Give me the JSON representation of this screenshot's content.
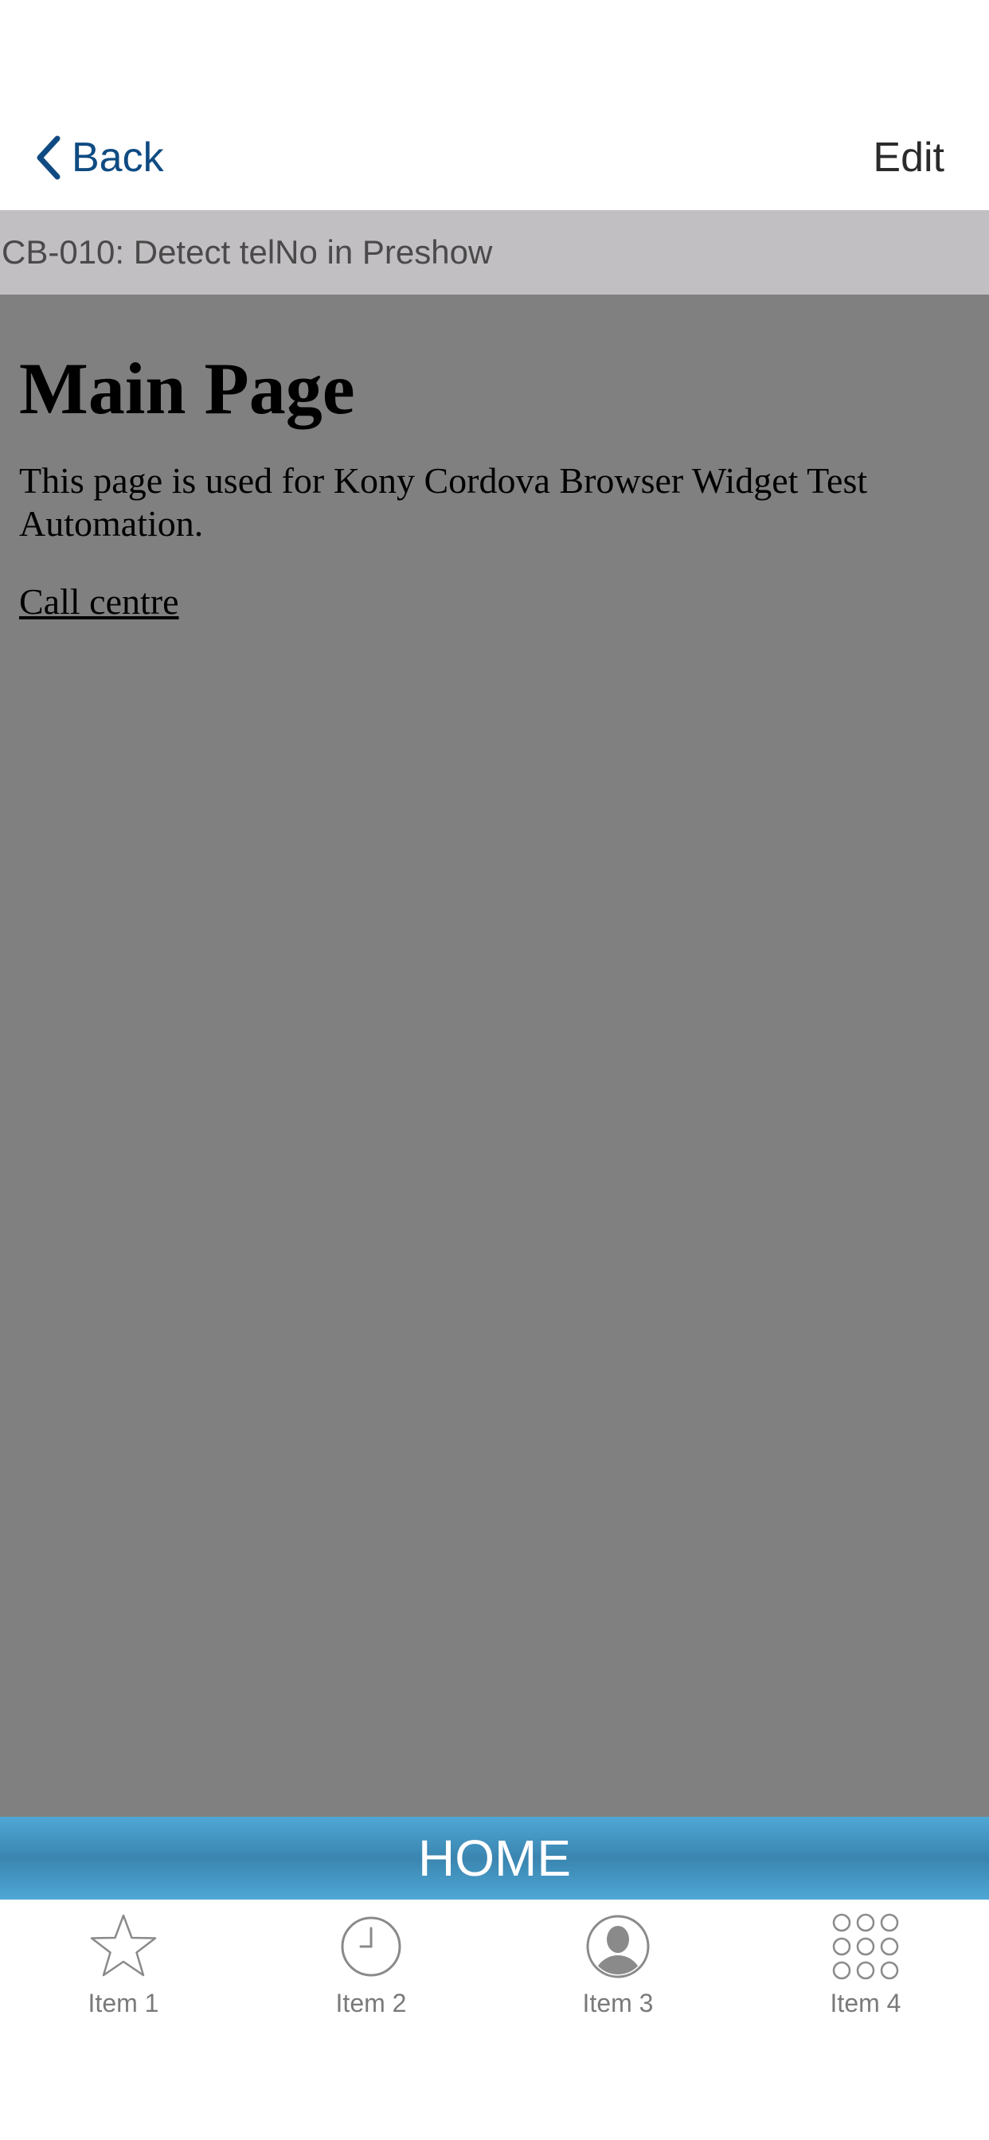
{
  "nav": {
    "back_label": "Back",
    "edit_label": "Edit",
    "accent_color": "#0f4b82"
  },
  "title_bar": {
    "text": "CB-010: Detect telNo in Preshow"
  },
  "browser": {
    "heading": "Main Page",
    "paragraph": "This page is used for Kony Cordova Browser Widget Test Automation.",
    "link_text": "Call centre",
    "background_color": "#808080"
  },
  "home_bar": {
    "label": "HOME",
    "color": "#4fa7d5"
  },
  "tabs": [
    {
      "label": "Item 1",
      "icon": "star-icon"
    },
    {
      "label": "Item 2",
      "icon": "clock-icon"
    },
    {
      "label": "Item 3",
      "icon": "user-icon"
    },
    {
      "label": "Item 4",
      "icon": "grid-icon"
    }
  ]
}
